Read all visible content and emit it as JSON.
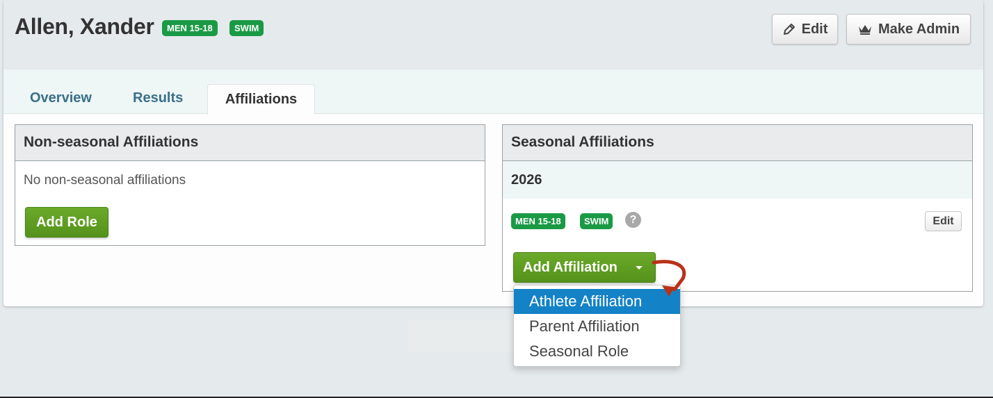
{
  "athlete": {
    "name": "Allen, Xander",
    "badges": [
      "MEN 15-18",
      "SWIM"
    ]
  },
  "header": {
    "edit_label": "Edit",
    "make_admin_label": "Make Admin"
  },
  "tabs": [
    {
      "label": "Overview",
      "active": false
    },
    {
      "label": "Results",
      "active": false
    },
    {
      "label": "Affiliations",
      "active": true
    }
  ],
  "non_seasonal": {
    "title": "Non-seasonal Affiliations",
    "empty_text": "No non-seasonal affiliations",
    "add_role_label": "Add Role"
  },
  "seasonal": {
    "title": "Seasonal Affiliations",
    "season": "2026",
    "badges": [
      "MEN 15-18",
      "SWIM"
    ],
    "help_icon": "?",
    "edit_label": "Edit",
    "add_affiliation_label": "Add Affiliation"
  },
  "dropdown": {
    "items": [
      "Athlete Affiliation",
      "Parent Affiliation",
      "Seasonal Role"
    ],
    "active_index": 0
  },
  "colors": {
    "badge": "#1a9a45",
    "primary_green": "#5fa024",
    "dropdown_active": "#1482c6",
    "annotation_arrow": "#b83219"
  }
}
